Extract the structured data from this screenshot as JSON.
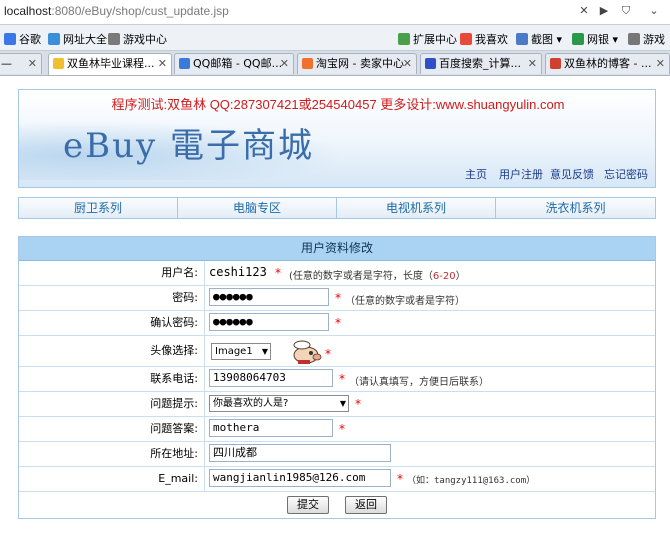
{
  "browser": {
    "url_host": "localhost",
    "url_rest": ":8080/eBuy/shop/cust_update.jsp",
    "bookmarks": [
      {
        "label": "谷歌",
        "color": "#3b78e7"
      },
      {
        "label": "网址大全",
        "color": "#3a8fd8"
      },
      {
        "label": "游戏中心",
        "color": "#7a7a7a"
      },
      {
        "label": "扩展中心",
        "color": "#4aa04a"
      },
      {
        "label": "我喜欢",
        "color": "#e84a3a"
      },
      {
        "label": "截图",
        "color": "#4a7ac8"
      },
      {
        "label": "网银",
        "color": "#2a9a4a"
      },
      {
        "label": "游戏",
        "color": "#777777"
      }
    ],
    "tabs": [
      {
        "label": "—",
        "color": "#cccccc"
      },
      {
        "label": "双鱼林毕业课程...",
        "color": "#f0c030"
      },
      {
        "label": "QQ邮箱 - QQ邮...",
        "color": "#3a7ad8"
      },
      {
        "label": "淘宝网 - 卖家中心",
        "color": "#f07030"
      },
      {
        "label": "百度搜索_计算...",
        "color": "#3050c8"
      },
      {
        "label": "双鱼林的博客 - ...",
        "color": "#d04030"
      }
    ]
  },
  "banner": {
    "promo": "程序测试:双鱼林 QQ:287307421或254540457 更多设计:www.shuangyulin.com",
    "logo": "eBuy 電子商城",
    "nav": [
      "主页",
      "用户注册",
      "意见反馈",
      "忘记密码"
    ]
  },
  "categories": [
    "厨卫系列",
    "电脑专区",
    "电视机系列",
    "洗衣机系列"
  ],
  "form": {
    "title": "用户资料修改",
    "username_label": "用户名:",
    "username_value": "ceshi123",
    "username_hint_a": "(任意的数字或者是字符，长度（",
    "username_hint_num": "6-20",
    "username_hint_b": "）",
    "password_label": "密码:",
    "password_value": "●●●●●●",
    "password_hint": "（任意的数字或者是字符）",
    "confirm_label": "确认密码:",
    "confirm_value": "●●●●●●",
    "avatar_label": "头像选择:",
    "avatar_value": "Image1",
    "phone_label": "联系电话:",
    "phone_value": "13908064703",
    "phone_hint": "（请认真填写，方便日后联系）",
    "question_label": "问题提示:",
    "question_value": "你最喜欢的人是?",
    "answer_label": "问题答案:",
    "answer_value": "mothera",
    "address_label": "所在地址:",
    "address_value": "四川成都",
    "email_label": "E_mail:",
    "email_value": "wangjianlin1985@126.com",
    "email_hint": "（如：tangzy111@163.com）",
    "submit_label": "提交",
    "back_label": "返回"
  }
}
